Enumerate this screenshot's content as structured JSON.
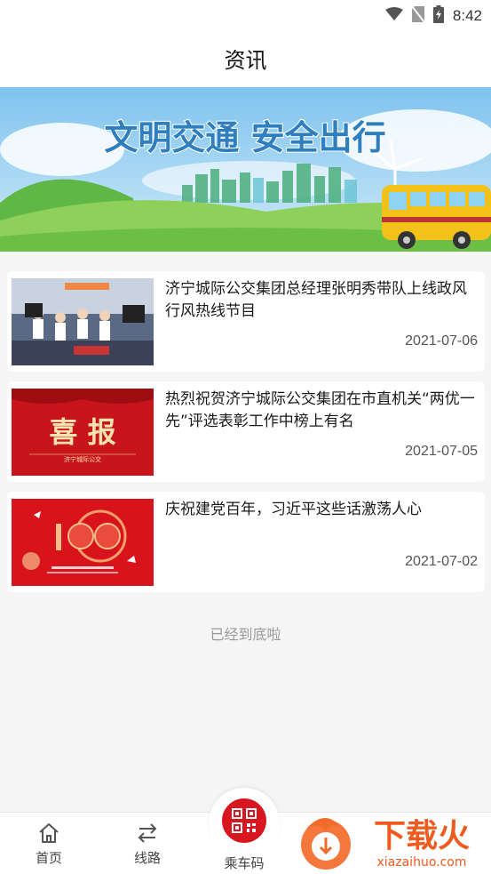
{
  "status_bar": {
    "time": "8:42"
  },
  "header": {
    "title": "资讯"
  },
  "banner": {
    "slogan": "文明交通 安全出行"
  },
  "news": [
    {
      "title": "济宁城际公交集团总经理张明秀带队上线政风行风热线节目",
      "date": "2021-07-06",
      "thumb": "studio-photo"
    },
    {
      "title": "热烈祝贺济宁城际公交集团在市直机关“两优一先”评选表彰工作中榜上有名",
      "date": "2021-07-05",
      "thumb": "red-poster",
      "thumb_text": "喜 报",
      "thumb_subtext": "济宁城际公交"
    },
    {
      "title": "庆祝建党百年，习近平这些话激荡人心",
      "date": "2021-07-02",
      "thumb": "party-100"
    }
  ],
  "end_text": "已经到底啦",
  "tabbar": {
    "home_label": "首页",
    "routes_label": "线路",
    "qr_label": "乘车码"
  },
  "watermark": {
    "brand": "下载火",
    "url": "xiazaihuo.com"
  },
  "colors": {
    "accent_red": "#d8161f",
    "background": "#f5f5f5"
  }
}
